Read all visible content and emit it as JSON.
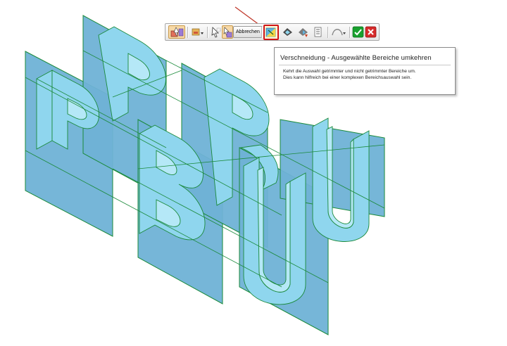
{
  "command_bar": {
    "cancel_label": "Abbrechen",
    "icons": [
      "select-tool-icon",
      "selection-filter-icon",
      "select-cursor-icon",
      "selection-mode-icon",
      "reverse-selection-icon",
      "trim-region-icon",
      "extend-region-icon",
      "list-icon",
      "arc-options-icon",
      "accept-icon",
      "cancel-icon"
    ],
    "highlight_color": "#d01616",
    "accept_color": "#18a12e",
    "cancel_color": "#d62b2b"
  },
  "tooltip": {
    "title": "Verschneidung - Ausgewählte Bereiche umkehren",
    "line1": "Kehrt die Auswahl getrimmter und nicht getrimmter Bereiche um.",
    "line2": "Dies kann hilfreich bei einer komplexen Bereichsauswahl sein."
  },
  "annotation": {
    "arrow_color": "#c0392b"
  },
  "model": {
    "plane_fill": "#6fb2d6",
    "solid_fill": "#8fd6ee",
    "edge_color": "#1a8a3a"
  }
}
